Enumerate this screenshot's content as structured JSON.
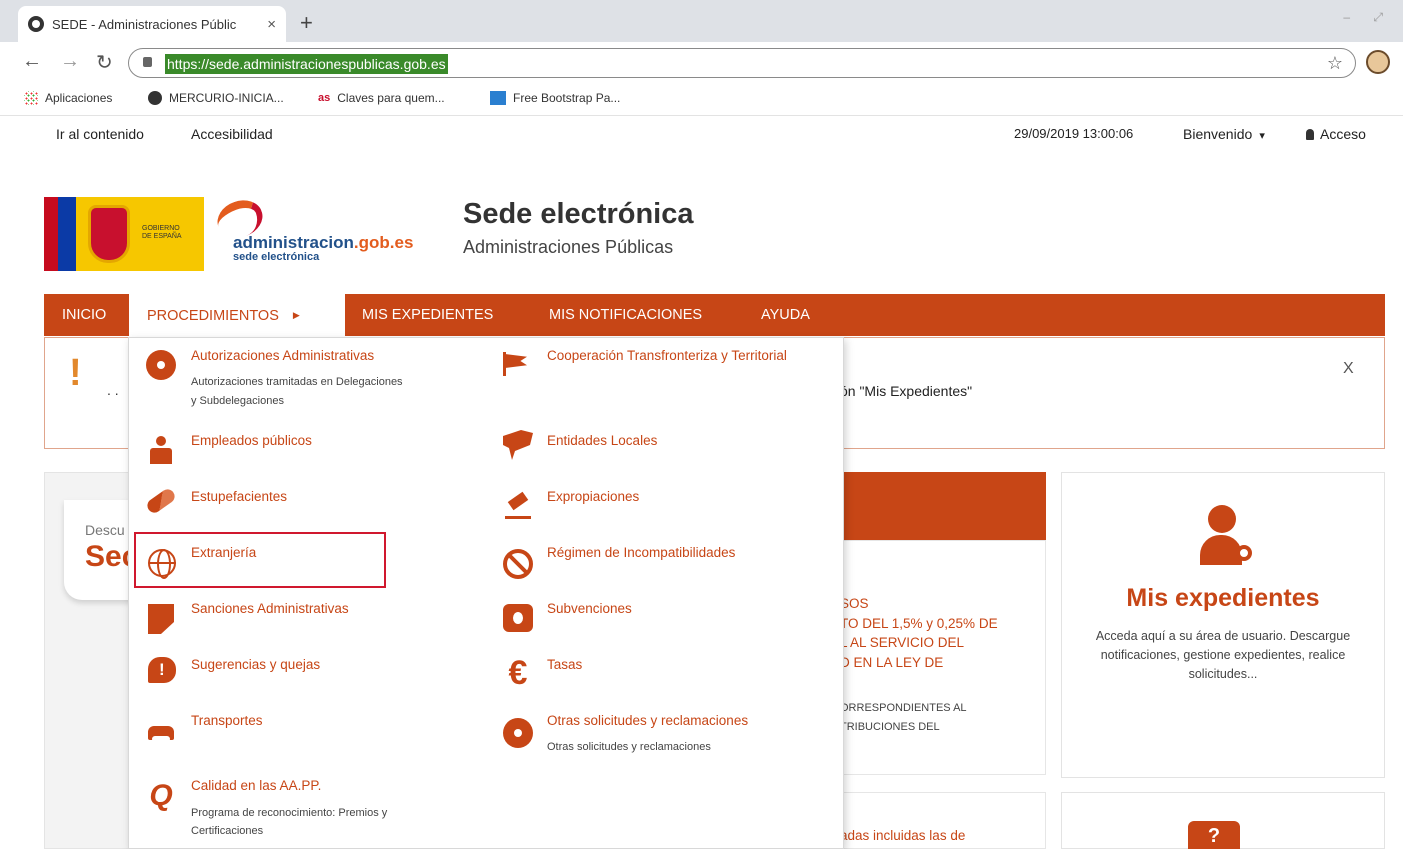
{
  "browser": {
    "tab_title": "SEDE - Administraciones Públic",
    "tab_close": "×",
    "new_tab": "+",
    "url": "https://sede.administracionespublicas.gob.es",
    "bookmarks": [
      {
        "label": "Aplicaciones",
        "icon": "apps-grid-icon"
      },
      {
        "label": "MERCURIO-INICIA...",
        "icon": "globe-icon"
      },
      {
        "label": "Claves para quem...",
        "icon": "as-logo-icon",
        "icon_text": "as"
      },
      {
        "label": "Free Bootstrap Pa...",
        "icon": "bootstrap-icon"
      }
    ]
  },
  "topbar": {
    "skip_link": "Ir al contenido",
    "accessibility": "Accesibilidad",
    "datetime": "29/09/2019 13:00:06",
    "welcome": "Bienvenido",
    "login": "Acceso"
  },
  "header": {
    "gov_text_1": "GOBIERNO",
    "gov_text_2": "DE ESPAÑA",
    "adm_name": "administracion",
    "adm_tld": ".gob.es",
    "adm_sub": "sede electrónica",
    "title": "Sede electrónica",
    "subtitle": "Administraciones Públicas"
  },
  "nav": {
    "items": [
      "INICIO",
      "PROCEDIMIENTOS",
      "MIS EXPEDIENTES",
      "MIS NOTIFICACIONES",
      "AYUDA"
    ],
    "accent": "#c74616"
  },
  "alert": {
    "icon": "!",
    "lead": ". .",
    "tail": "ón \"Mis Expedientes\"",
    "close": "X"
  },
  "dropdown": {
    "left": [
      {
        "label": "Autorizaciones Administrativas",
        "desc1": "Autorizaciones tramitadas en Delegaciones",
        "desc2": "y Subdelegaciones",
        "icon": "gear-icon"
      },
      {
        "label": "Empleados públicos",
        "icon": "employee-icon"
      },
      {
        "label": "Estupefacientes",
        "icon": "pill-icon"
      },
      {
        "label": "Extranjería",
        "icon": "globe-icon"
      },
      {
        "label": "Sanciones Administrativas",
        "icon": "document-icon"
      },
      {
        "label": "Sugerencias y quejas",
        "icon": "complaint-icon"
      },
      {
        "label": "Transportes",
        "icon": "car-icon"
      },
      {
        "label": "Calidad en las AA.PP.",
        "desc1": "Programa de reconocimiento: Premios y",
        "desc2": "Certificaciones",
        "icon": "quality-icon"
      }
    ],
    "right": [
      {
        "label": "Cooperación Transfronteriza y Territorial",
        "icon": "flag-icon"
      },
      {
        "label": "Entidades Locales",
        "icon": "map-icon"
      },
      {
        "label": "Expropiaciones",
        "icon": "gavel-icon"
      },
      {
        "label": "Régimen de Incompatibilidades",
        "icon": "ban-icon"
      },
      {
        "label": "Subvenciones",
        "icon": "money-icon"
      },
      {
        "label": "Tasas",
        "icon": "euro-icon"
      },
      {
        "label": "Otras solicitudes y reclamaciones",
        "desc1": "Otras solicitudes y reclamaciones",
        "icon": "gear-icon"
      }
    ]
  },
  "promo": {
    "small": "Descu",
    "big": "Sec"
  },
  "news": {
    "line1": "SOS",
    "line2": "TO DEL 1,5% y 0,25% DE",
    "line3": "L AL SERVICIO DEL",
    "line4": "D EN LA LEY DE",
    "small1": "ORRESPONDIENTES AL",
    "small2": "TRIBUCIONES DEL",
    "tail": "adas incluidas las de"
  },
  "card": {
    "title": "Mis expedientes",
    "text": "Acceda aquí a su área de usuario. Descargue notificaciones, gestione expedientes, realice solicitudes..."
  },
  "help": {
    "icon_text": "?"
  }
}
